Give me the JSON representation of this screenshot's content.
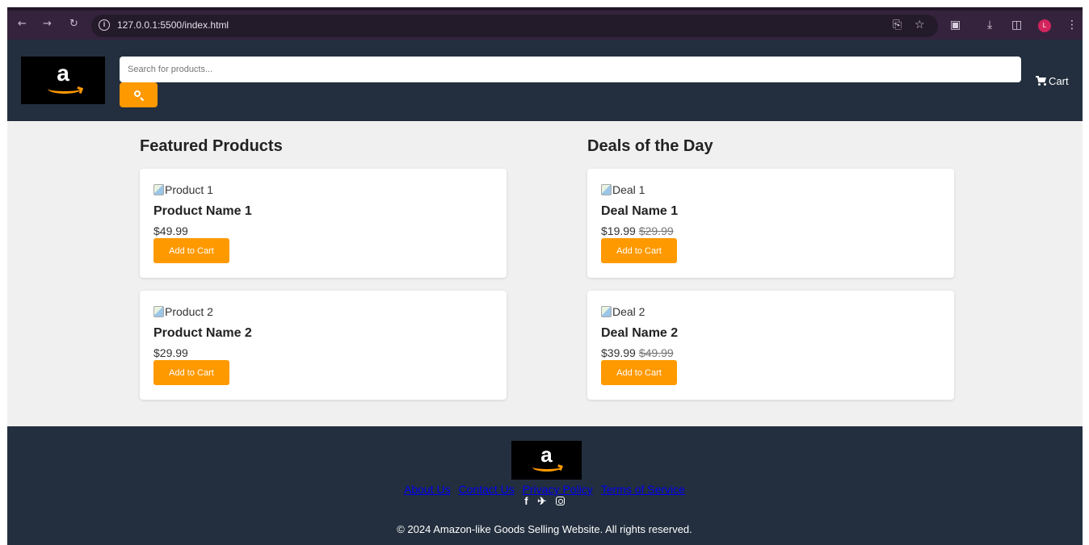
{
  "browser": {
    "url": "127.0.0.1:5500/index.html",
    "profile_initial": "L",
    "nav_icons": [
      "back-arrow-icon",
      "forward-arrow-icon",
      "reload-icon"
    ],
    "toolbar_icons": [
      "cast-icon",
      "star-icon",
      "extensions-icon",
      "download-icon",
      "side-panel-icon",
      "kebab-menu-icon"
    ]
  },
  "header": {
    "logo_letter": "a",
    "search_placeholder": "Search for products...",
    "cart_label": "Cart"
  },
  "sections": [
    {
      "title": "Featured Products",
      "items": [
        {
          "img_alt": "Product 1",
          "name": "Product Name 1",
          "price": "$49.99",
          "button": "Add to Cart"
        },
        {
          "img_alt": "Product 2",
          "name": "Product Name 2",
          "price": "$29.99",
          "button": "Add to Cart"
        }
      ]
    },
    {
      "title": "Deals of the Day",
      "items": [
        {
          "img_alt": "Deal 1",
          "name": "Deal Name 1",
          "price": "$19.99",
          "old_price": "$29.99",
          "button": "Add to Cart"
        },
        {
          "img_alt": "Deal 2",
          "name": "Deal Name 2",
          "price": "$39.99",
          "old_price": "$49.99",
          "button": "Add to Cart"
        }
      ]
    }
  ],
  "footer": {
    "logo_letter": "a",
    "links": [
      "About Us",
      "Contact Us",
      "Privacy Policy",
      "Terms of Service"
    ],
    "social_icons": [
      "facebook-icon",
      "twitter-icon",
      "instagram-icon"
    ],
    "copyright": "© 2024 Amazon-like Goods Selling Website. All rights reserved."
  },
  "colors": {
    "header_bg": "#232f3e",
    "accent": "#ff9900",
    "page_bg": "#f0f0f0",
    "chrome_bg": "#35233d",
    "link": "#0000ee"
  }
}
